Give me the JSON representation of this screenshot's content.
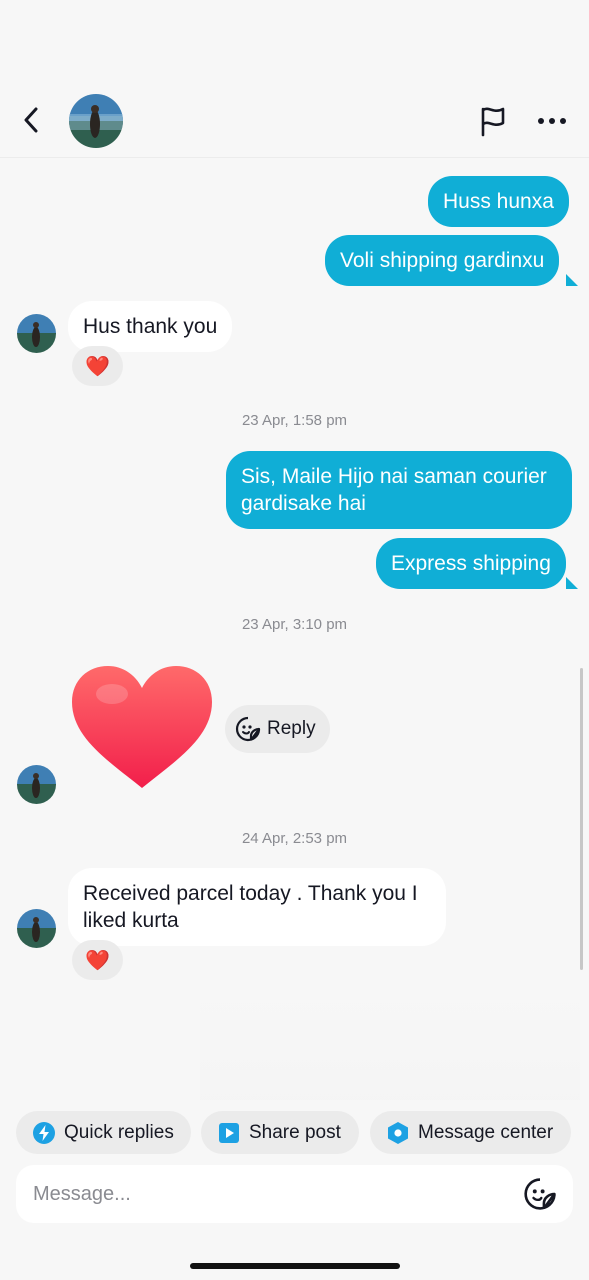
{
  "header": {
    "back_icon": "chevron-left-icon",
    "flag_icon": "flag-icon",
    "more_icon": "more-horizontal-icon"
  },
  "messages": [
    {
      "direction": "outgoing",
      "text": "Huss hunxa"
    },
    {
      "direction": "outgoing",
      "text": "Voli shipping gardinxu"
    },
    {
      "direction": "incoming",
      "text": "Hus thank you",
      "reaction": "❤️"
    },
    {
      "timestamp": "23 Apr, 1:58 pm"
    },
    {
      "direction": "outgoing",
      "text": "Sis, Maile Hijo nai saman courier gardisake hai"
    },
    {
      "direction": "outgoing",
      "text": "Express shipping"
    },
    {
      "timestamp": "23 Apr, 3:10 pm"
    },
    {
      "direction": "incoming",
      "type": "heart-sticker",
      "reply_label": "Reply"
    },
    {
      "timestamp": "24 Apr, 2:53 pm"
    },
    {
      "direction": "incoming",
      "text": "Received parcel today . Thank you I liked kurta",
      "reaction": "❤️"
    }
  ],
  "quick_actions": [
    {
      "label": "Quick replies",
      "icon": "lightning-icon",
      "color": "#1da1e3"
    },
    {
      "label": "Share post",
      "icon": "play-icon",
      "color": "#1da1e3"
    },
    {
      "label": "Message center",
      "icon": "hexagon-icon",
      "color": "#1da1e3"
    }
  ],
  "composer": {
    "placeholder": "Message...",
    "sticker_icon": "sticker-smile-icon"
  },
  "colors": {
    "outgoing_bubble": "#10aed6",
    "incoming_bubble": "#ffffff",
    "background": "#f7f7f7"
  }
}
